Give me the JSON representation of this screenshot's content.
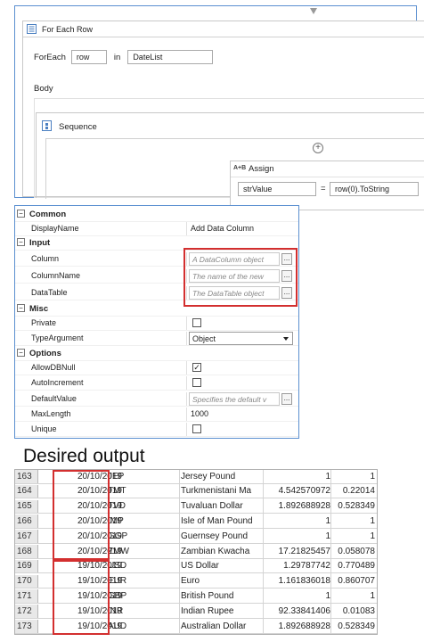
{
  "designer": {
    "foreach_title": "For Each Row",
    "foreach_label": "ForEach",
    "row_var": "row",
    "in_label": "in",
    "collection": "DateList",
    "body_label": "Body",
    "sequence_title": "Sequence",
    "assign_icon": "A+B",
    "assign_title": "Assign",
    "assign_to": "strValue",
    "equals": "=",
    "assign_value": "row(0).ToString"
  },
  "properties": {
    "categories": {
      "common": "Common",
      "input": "Input",
      "misc": "Misc",
      "options": "Options"
    },
    "display_name_label": "DisplayName",
    "display_name_value": "Add Data Column",
    "column_label": "Column",
    "column_placeholder": "A DataColumn object",
    "column_name_label": "ColumnName",
    "column_name_placeholder": "The name of the new",
    "datatable_label": "DataTable",
    "datatable_placeholder": "The DataTable object",
    "private_label": "Private",
    "type_argument_label": "TypeArgument",
    "type_argument_value": "Object",
    "allow_db_null_label": "AllowDBNull",
    "allow_db_null_checked": true,
    "auto_increment_label": "AutoIncrement",
    "default_value_label": "DefaultValue",
    "default_value_placeholder": "Specifies the default v",
    "max_length_label": "MaxLength",
    "max_length_value": "1000",
    "unique_label": "Unique",
    "ellipsis": "..."
  },
  "output": {
    "heading": "Desired output",
    "rows": [
      {
        "n": "163",
        "date": "20/10/2019",
        "code": "JEP",
        "name": "Jersey Pound",
        "v1": "1",
        "v2": "1"
      },
      {
        "n": "164",
        "date": "20/10/2019",
        "code": "TMT",
        "name": "Turkmenistani Ma",
        "v1": "4.542570972",
        "v2": "0.22014"
      },
      {
        "n": "165",
        "date": "20/10/2019",
        "code": "TVD",
        "name": "Tuvaluan Dollar",
        "v1": "1.892688928",
        "v2": "0.528349"
      },
      {
        "n": "166",
        "date": "20/10/2019",
        "code": "IMP",
        "name": "Isle of Man Pound",
        "v1": "1",
        "v2": "1"
      },
      {
        "n": "167",
        "date": "20/10/2019",
        "code": "GGP",
        "name": "Guernsey Pound",
        "v1": "1",
        "v2": "1"
      },
      {
        "n": "168",
        "date": "20/10/2019",
        "code": "ZMW",
        "name": "Zambian Kwacha",
        "v1": "17.21825457",
        "v2": "0.058078"
      },
      {
        "n": "169",
        "date": "19/10/2019",
        "code": "USD",
        "name": "US Dollar",
        "v1": "1.29787742",
        "v2": "0.770489"
      },
      {
        "n": "170",
        "date": "19/10/2019",
        "code": "EUR",
        "name": "Euro",
        "v1": "1.161836018",
        "v2": "0.860707"
      },
      {
        "n": "171",
        "date": "19/10/2019",
        "code": "GBP",
        "name": "British Pound",
        "v1": "1",
        "v2": "1"
      },
      {
        "n": "172",
        "date": "19/10/2019",
        "code": "INR",
        "name": "Indian Rupee",
        "v1": "92.33841406",
        "v2": "0.01083"
      },
      {
        "n": "173",
        "date": "19/10/2019",
        "code": "AUD",
        "name": "Australian Dollar",
        "v1": "1.892688928",
        "v2": "0.528349"
      }
    ]
  }
}
